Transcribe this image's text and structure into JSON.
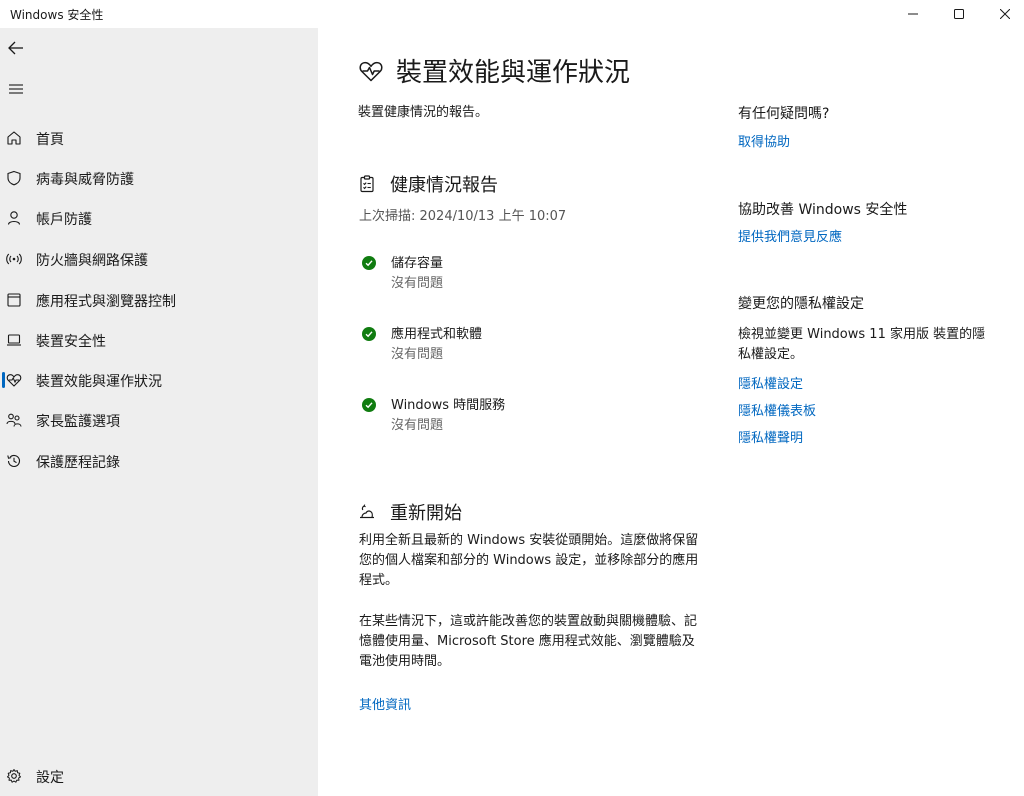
{
  "window": {
    "title": "Windows 安全性"
  },
  "sidebar": {
    "items": [
      {
        "label": "首頁",
        "icon": "home-icon"
      },
      {
        "label": "病毒與威脅防護",
        "icon": "shield-icon"
      },
      {
        "label": "帳戶防護",
        "icon": "person-icon"
      },
      {
        "label": "防火牆與網路保護",
        "icon": "wifi-icon"
      },
      {
        "label": "應用程式與瀏覽器控制",
        "icon": "app-window-icon"
      },
      {
        "label": "裝置安全性",
        "icon": "laptop-icon"
      },
      {
        "label": "裝置效能與運作狀況",
        "icon": "heart-pulse-icon",
        "active": true
      },
      {
        "label": "家長監護選項",
        "icon": "family-icon"
      },
      {
        "label": "保護歷程記錄",
        "icon": "history-icon"
      }
    ],
    "settings_label": "設定"
  },
  "main": {
    "title": "裝置效能與運作狀況",
    "subtitle": "裝置健康情況的報告。",
    "health_report": {
      "title": "健康情況報告",
      "last_scan": "上次掃描: 2024/10/13 上午 10:07",
      "items": [
        {
          "name": "儲存容量",
          "status": "沒有問題"
        },
        {
          "name": "應用程式和軟體",
          "status": "沒有問題"
        },
        {
          "name": "Windows 時間服務",
          "status": "沒有問題"
        }
      ]
    },
    "fresh_start": {
      "title": "重新開始",
      "paragraph1": "利用全新且最新的 Windows 安裝從頭開始。這麼做將保留您的個人檔案和部分的 Windows 設定，並移除部分的應用程式。",
      "paragraph2": "在某些情況下，這或許能改善您的裝置啟動與關機體驗、記憶體使用量、Microsoft Store 應用程式效能、瀏覽體驗及電池使用時間。",
      "link": "其他資訊"
    }
  },
  "side_panel": {
    "question_heading": "有任何疑問嗎?",
    "help_link": "取得協助",
    "improve_heading": "協助改善 Windows 安全性",
    "feedback_link": "提供我們意見反應",
    "privacy_heading": "變更您的隱私權設定",
    "privacy_text": "檢視並變更 Windows 11 家用版 裝置的隱私權設定。",
    "privacy_settings_link": "隱私權設定",
    "privacy_dashboard_link": "隱私權儀表板",
    "privacy_statement_link": "隱私權聲明"
  },
  "colors": {
    "accent": "#0067c0",
    "success": "#107c10",
    "sidebar_bg": "#eeeeee"
  }
}
